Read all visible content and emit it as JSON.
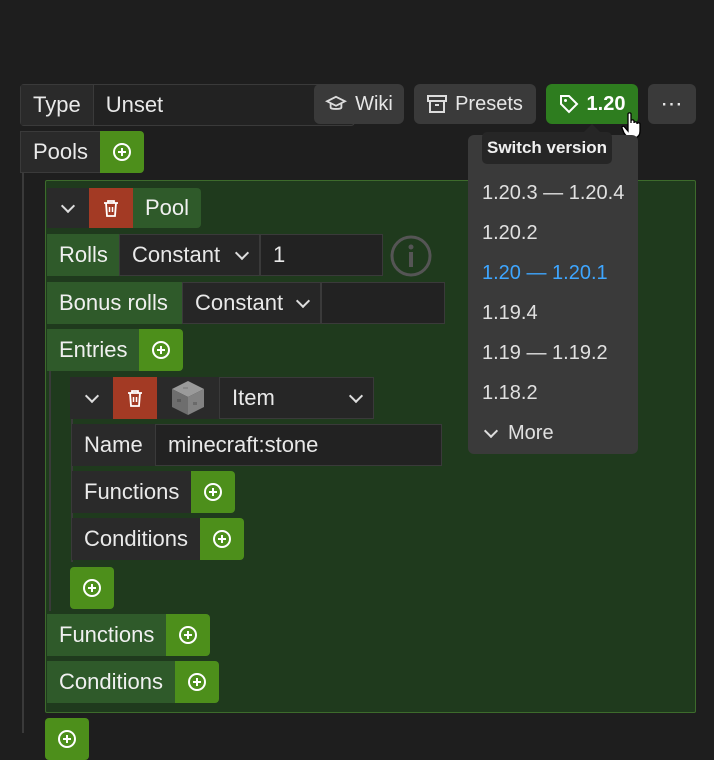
{
  "toolbar": {
    "type_label": "Type",
    "type_value": "Unset",
    "wiki_label": "Wiki",
    "presets_label": "Presets",
    "version_label": "1.20",
    "more_glyph": "⋯"
  },
  "tooltip": {
    "text": "Switch version"
  },
  "version_menu": {
    "items": [
      "1.20.3 — 1.20.4",
      "1.20.2",
      "1.20 — 1.20.1",
      "1.19.4",
      "1.19 — 1.19.2",
      "1.18.2"
    ],
    "selected_index": 2,
    "more_label": "More",
    "selected_color": "#3ea6ff"
  },
  "pools": {
    "label": "Pools",
    "pool": {
      "label": "Pool",
      "rolls_label": "Rolls",
      "rolls_mode": "Constant",
      "rolls_value": "1",
      "bonus_label": "Bonus rolls",
      "bonus_mode": "Constant",
      "bonus_value": "",
      "entries_label": "Entries",
      "entry": {
        "type": "Item",
        "name_label": "Name",
        "name_value": "minecraft:stone",
        "functions_label": "Functions",
        "conditions_label": "Conditions"
      },
      "functions_label": "Functions",
      "conditions_label": "Conditions"
    }
  },
  "colors": {
    "accent_green": "#4d8f1b",
    "label_green": "#2f5a2a",
    "delete_red": "#a33a24",
    "panel_green": "#1f3a1d"
  }
}
